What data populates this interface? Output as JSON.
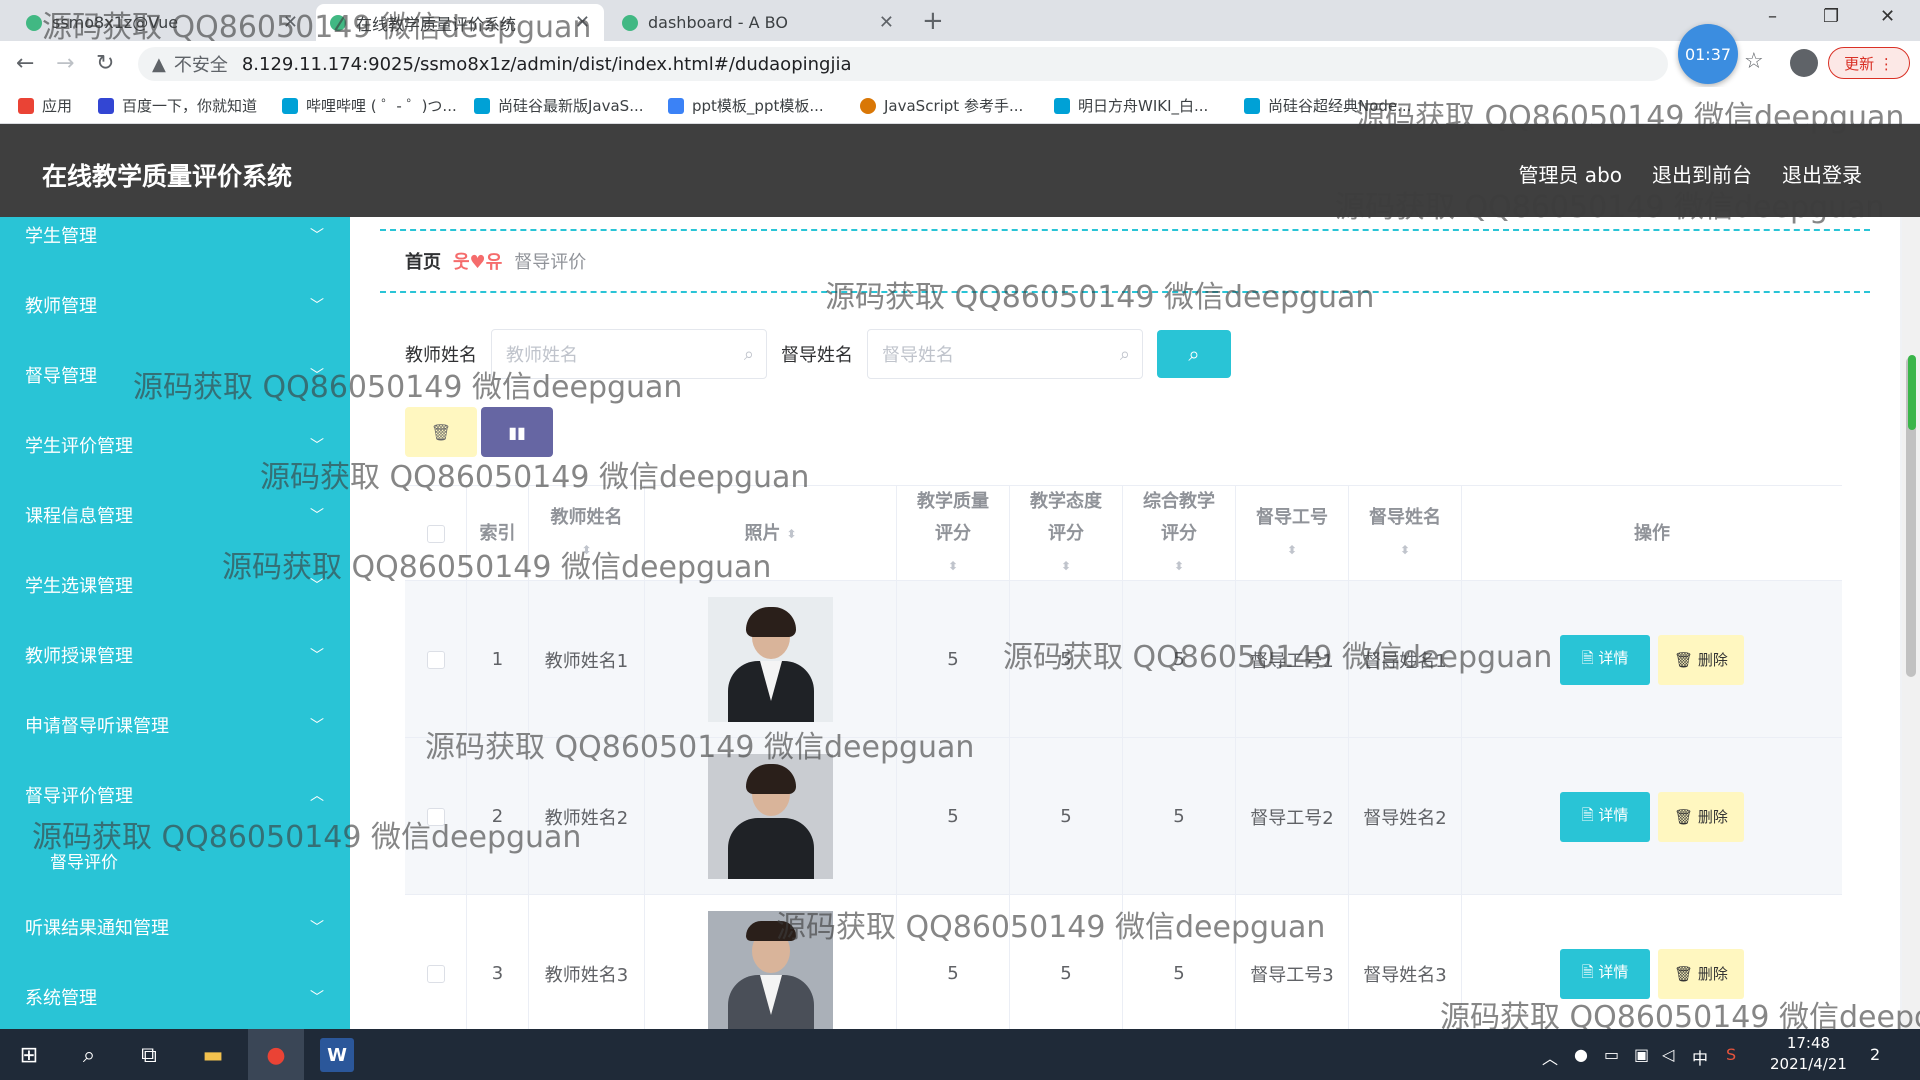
{
  "browser": {
    "tabs": [
      {
        "label": "ssmo8x1z@Vue",
        "active": false
      },
      {
        "label": "在线教学质量评价系统",
        "active": true
      },
      {
        "label": "dashboard - A BO",
        "active": false
      }
    ],
    "new_tab": "+",
    "window_controls": {
      "minimize": "–",
      "maximize": "❐",
      "close": "✕"
    },
    "nav": {
      "back": "←",
      "forward": "→",
      "reload": "↻"
    },
    "security_warning": "▲",
    "security_label": "不安全",
    "url": "8.129.11.174:9025/ssmo8x1z/admin/dist/index.html#/dudaopingjia",
    "timer": "01:37",
    "update_label": "更新 ⋮",
    "bookmarks": [
      {
        "label": "应用",
        "color": "#ea4335"
      },
      {
        "label": "百度一下，你就知道",
        "color": "#3346d3"
      },
      {
        "label": "哔哩哔哩 ( ゜- ゜)つ...",
        "color": "#00a1d6"
      },
      {
        "label": "尚硅谷最新版JavaS...",
        "color": "#00a1d6"
      },
      {
        "label": "ppt模板_ppt模板...",
        "color": "#3b82f6"
      },
      {
        "label": "JavaScript 参考手...",
        "color": "#d97706"
      },
      {
        "label": "明日方舟WIKI_白...",
        "color": "#00a1d6"
      },
      {
        "label": "尚硅谷超经典Node...",
        "color": "#00a1d6"
      }
    ]
  },
  "header": {
    "title": "在线教学质量评价系统",
    "links": [
      "管理员 abo",
      "退出到前台",
      "退出登录"
    ]
  },
  "sidebar": {
    "items": [
      {
        "label": "学生管理",
        "chevron": "﹀"
      },
      {
        "label": "教师管理",
        "chevron": "﹀"
      },
      {
        "label": "督导管理",
        "chevron": "﹀"
      },
      {
        "label": "学生评价管理",
        "chevron": "﹀"
      },
      {
        "label": "课程信息管理",
        "chevron": "﹀"
      },
      {
        "label": "学生选课管理",
        "chevron": "﹀"
      },
      {
        "label": "教师授课管理",
        "chevron": "﹀"
      },
      {
        "label": "申请督导听课管理",
        "chevron": "﹀"
      },
      {
        "label": "督导评价管理",
        "chevron": "︿"
      },
      {
        "label": "听课结果通知管理",
        "chevron": "﹀"
      },
      {
        "label": "系统管理",
        "chevron": "﹀"
      }
    ],
    "subitem": "督导评价"
  },
  "breadcrumb": {
    "home": "首页",
    "separator": "웃♥유",
    "current": "督导评价"
  },
  "search": {
    "teacher_label": "教师姓名",
    "teacher_placeholder": "教师姓名",
    "supervisor_label": "督导姓名",
    "supervisor_placeholder": "督导姓名",
    "button_icon": "⌕"
  },
  "actions": {
    "delete_icon": "🗑",
    "stats_icon": "▮▮"
  },
  "table": {
    "headers": {
      "index": "索引",
      "teacher": "教师姓名",
      "photo": "照片",
      "quality": "教学质量评分",
      "attitude": "教学态度评分",
      "overall": "综合教学评分",
      "sup_id": "督导工号",
      "sup_name": "督导姓名",
      "ops": "操作"
    },
    "sort_icon": "⬍",
    "rows": [
      {
        "index": "1",
        "teacher": "教师姓名1",
        "quality": "5",
        "attitude": "5",
        "overall": "5",
        "sup_id": "督导工号1",
        "sup_name": "督导姓名1"
      },
      {
        "index": "2",
        "teacher": "教师姓名2",
        "quality": "5",
        "attitude": "5",
        "overall": "5",
        "sup_id": "督导工号2",
        "sup_name": "督导姓名2"
      },
      {
        "index": "3",
        "teacher": "教师姓名3",
        "quality": "5",
        "attitude": "5",
        "overall": "5",
        "sup_id": "督导工号3",
        "sup_name": "督导姓名3"
      }
    ],
    "detail_label": "🗎 详情",
    "delete_label": "🗑 删除"
  },
  "watermark": "源码获取 QQ86050149 微信deepguan",
  "taskbar": {
    "start": "⊞",
    "search": "⌕",
    "taskview": "⧉",
    "explorer": "▬",
    "chrome": "●",
    "word": "W",
    "tray": [
      "︿",
      "中"
    ],
    "time": "17:48",
    "date": "2021/4/21",
    "notification": "2"
  },
  "colors": {
    "accent": "#29c4d6",
    "header": "#3f3f3f",
    "stats_button": "#6666a3",
    "warning_button": "#fff7c0"
  }
}
